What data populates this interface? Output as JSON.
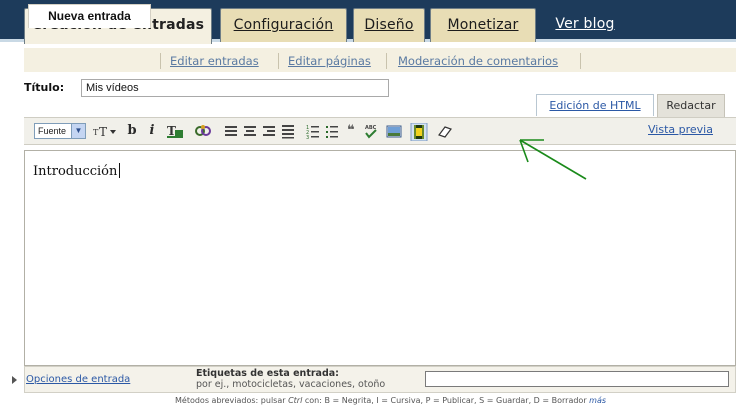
{
  "main_tabs": [
    "Creación de entradas",
    "Configuración",
    "Diseño",
    "Monetizar",
    "Ver blog"
  ],
  "sub_tabs": [
    "Nueva entrada",
    "Editar entradas",
    "Editar páginas",
    "Moderación de comentarios"
  ],
  "title_field": {
    "label": "Título:",
    "value": "Mis vídeos"
  },
  "mode_tabs": {
    "html": "Edición de HTML",
    "compose": "Redactar"
  },
  "toolbar": {
    "font_select": "Fuente",
    "size_icon": "font-size-icon",
    "bold": "b",
    "italic": "i",
    "text_color_icon": "text-color-icon",
    "link_icon": "link-icon",
    "align_left_icon": "align-left-icon",
    "align_center_icon": "align-center-icon",
    "align_right_icon": "align-right-icon",
    "justify_icon": "justify-icon",
    "numbered_list_icon": "numbered-list-icon",
    "bulleted_list_icon": "bulleted-list-icon",
    "quote_icon": "quote-icon",
    "spellcheck_icon": "spellcheck-icon",
    "image_icon": "image-icon",
    "video_icon": "video-icon",
    "eraser_icon": "eraser-icon",
    "preview_link": "Vista previa"
  },
  "editor": {
    "content": "Introducción"
  },
  "options": {
    "link": "Opciones de entrada",
    "labels_title": "Etiquetas de esta entrada:",
    "labels_hint": "por ej., motocicletas, vacaciones, otoño",
    "labels_value": ""
  },
  "shortcuts": {
    "prefix": "Métodos abreviados: pulsar",
    "key": "Ctrl",
    "con": "con:",
    "items": "B = Negrita, I = Cursiva, P = Publicar, S = Guardar, D = Borrador",
    "more": "más"
  },
  "annotation": {
    "arrow_color": "#1a8a1a",
    "points_to": "video-icon"
  },
  "colors": {
    "header_bg": "#1d3b5b",
    "tab_bg": "#e8ddb5",
    "link": "#2b58a5"
  }
}
